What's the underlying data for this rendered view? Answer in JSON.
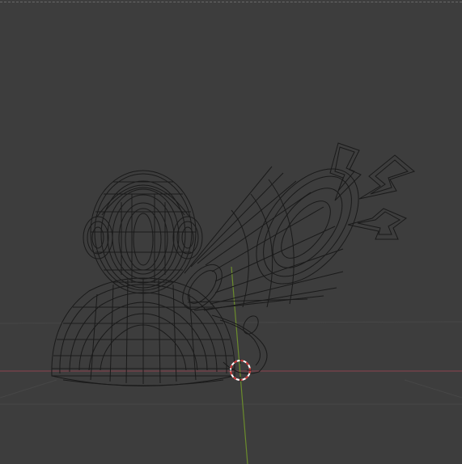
{
  "viewport": {
    "mode": "wireframe",
    "background_color": "#3d3d3d",
    "grid_line_color": "#474747",
    "x_axis_color": "#8a4450",
    "y_axis_color": "#6b8c2c",
    "wire_color": "#1a1a1a",
    "cursor_primary_color": "#c83232",
    "cursor_secondary_color": "#ffffff"
  },
  "scene_objects": [
    {
      "name": "character-head",
      "type": "mesh"
    },
    {
      "name": "headphones",
      "type": "mesh"
    },
    {
      "name": "character-body",
      "type": "mesh"
    },
    {
      "name": "megaphone",
      "type": "mesh"
    },
    {
      "name": "lightning-bolt-top",
      "type": "mesh"
    },
    {
      "name": "lightning-bolt-middle",
      "type": "mesh"
    },
    {
      "name": "lightning-bolt-bottom",
      "type": "mesh"
    }
  ]
}
